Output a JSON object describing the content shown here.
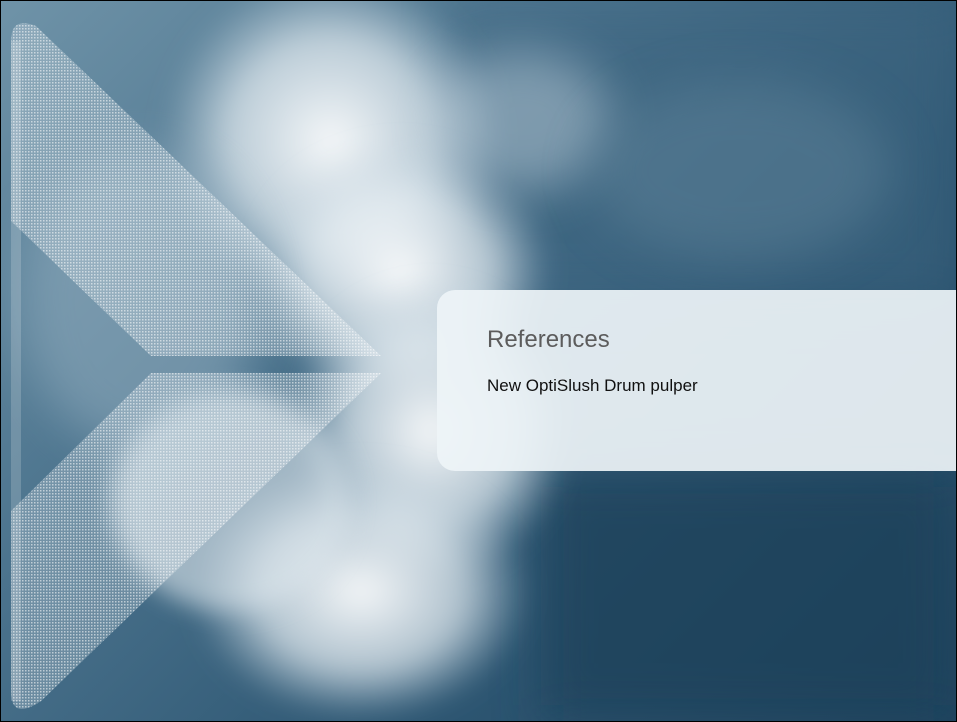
{
  "slide": {
    "title": "References",
    "subtitle": "New OptiSlush Drum pulper"
  },
  "theme": {
    "sky_dark": "#1f4560",
    "sky_mid": "#4b738d",
    "cloud": "#ffffff",
    "panel": "#eef4f7",
    "title_color": "#5c5c5c",
    "subtitle_color": "#111111"
  }
}
